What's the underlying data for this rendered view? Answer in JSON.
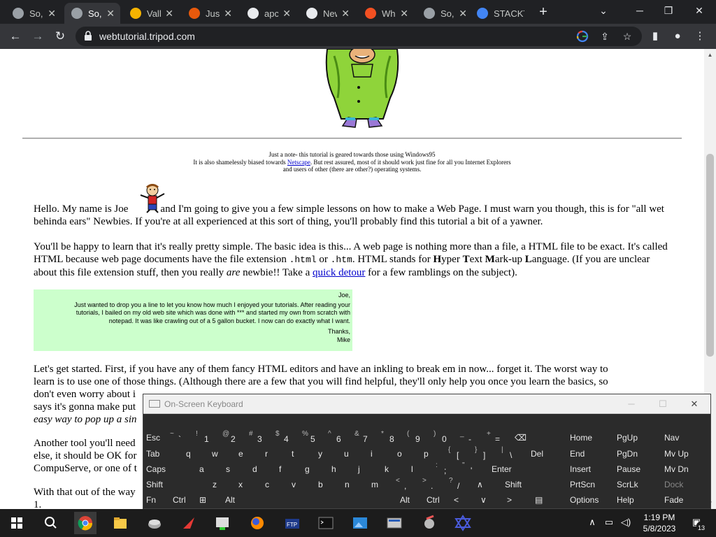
{
  "browser": {
    "tabs": [
      {
        "label": "So,",
        "icon": "globe-icon"
      },
      {
        "label": "So,",
        "icon": "globe-icon",
        "active": true
      },
      {
        "label": "Vall",
        "icon": "valley-logo-icon"
      },
      {
        "label": "Just",
        "icon": "scissors-icon"
      },
      {
        "label": "apc",
        "icon": "museum-icon"
      },
      {
        "label": "New",
        "icon": "chatgpt-icon"
      },
      {
        "label": "Wh",
        "icon": "microsoft-icon"
      },
      {
        "label": "So,",
        "icon": "globe-icon"
      },
      {
        "label": "STACKT",
        "icon": "stack-icon"
      }
    ],
    "url": "webtutorial.tripod.com",
    "new_tab": "+"
  },
  "page": {
    "note_line1": "Just a note- this tutorial is geared towards those using Windows95",
    "note_line2_a": "It is also shamelessly biased towards ",
    "note_link": "Netscape",
    "note_line2_b": ". But rest assured, most of it should work just fine for all you Internet Explorers",
    "note_line3": "and users of other (there are other?) operating systems.",
    "p1_a": "Hello. My name is Joe",
    "p1_b": "and I'm going to give you a few simple lessons on how to make a Web Page. I must warn you though, this is for \"all wet behinda ears\" Newbies. If you're at all experienced at this sort of thing, you'll probably find this tutorial a bit of a yawner.",
    "p2_a": "You'll be happy to learn that it's really pretty simple. The basic idea is this... A web page is nothing more than a file, a HTML file to be exact. It's called HTML because web page documents have the file extension ",
    "p2_ext1": ".html",
    "p2_or": " or ",
    "p2_ext2": ".htm",
    "p2_b": ". HTML stands for ",
    "p2_H": "H",
    "p2_yper": "yper ",
    "p2_T": "T",
    "p2_ext": "ext ",
    "p2_M": "M",
    "p2_arkup": "ark-up ",
    "p2_L": "L",
    "p2_anguage": "anguage. (If you are unclear about this file extension stuff, then you really ",
    "p2_are": "are",
    "p2_newbie": " newbie!! Take a ",
    "p2_link": "quick detour",
    "p2_end": " for a few ramblings on the subject).",
    "letter": {
      "greeting": "Joe,",
      "body": "Just wanted to drop you a line to let you know how much I enjoyed your tutorials. After reading your tutorials, I bailed on my old web site which was done with *** and started my own from scratch with notepad. It was like crawling out of a 5 gallon bucket. I now can do exactly what I want.",
      "thanks": "Thanks,",
      "sign": "Mike"
    },
    "p3_line1": "Let's get started. First, if you have any of them fancy HTML editors and have an inkling to break em in now... forget it. The worst way to",
    "p3_line2": "learn is to use one of those things. (Although there are a few that you will find helpful, they'll only help you once you learn the basics, so",
    "p3_line3": "don't even worry about i",
    "p3_line3b": "else, it should be OK for",
    "p3_says": "says it's gonna make put",
    "p3_easy": "easy way to pop up a sin",
    "p4_line1": "Another tool you'll need",
    "p4_line2": "else, it should be OK for",
    "p4_line3": "CompuServe, or one of t",
    "p5_line1": "With that out of the way",
    "p5_line2": "1."
  },
  "osk": {
    "title": "On-Screen Keyboard",
    "row1": [
      {
        "l": "Esc"
      },
      {
        "u": "~",
        "d": "`"
      },
      {
        "u": "!",
        "d": "1"
      },
      {
        "u": "@",
        "d": "2"
      },
      {
        "u": "#",
        "d": "3"
      },
      {
        "u": "$",
        "d": "4"
      },
      {
        "u": "%",
        "d": "5"
      },
      {
        "u": "^",
        "d": "6"
      },
      {
        "u": "&",
        "d": "7"
      },
      {
        "u": "*",
        "d": "8"
      },
      {
        "u": "(",
        "d": "9"
      },
      {
        "u": ")",
        "d": "0"
      },
      {
        "u": "_",
        "d": "-"
      },
      {
        "u": "+",
        "d": "="
      },
      {
        "l": "⌫"
      }
    ],
    "row2": [
      {
        "l": "Tab"
      },
      {
        "l": "q"
      },
      {
        "l": "w"
      },
      {
        "l": "e"
      },
      {
        "l": "r"
      },
      {
        "l": "t"
      },
      {
        "l": "y"
      },
      {
        "l": "u"
      },
      {
        "l": "i"
      },
      {
        "l": "o"
      },
      {
        "l": "p"
      },
      {
        "u": "{",
        "d": "["
      },
      {
        "u": "}",
        "d": "]"
      },
      {
        "u": "|",
        "d": "\\"
      },
      {
        "l": "Del"
      }
    ],
    "row3": [
      {
        "l": "Caps"
      },
      {
        "l": "a"
      },
      {
        "l": "s"
      },
      {
        "l": "d"
      },
      {
        "l": "f"
      },
      {
        "l": "g"
      },
      {
        "l": "h"
      },
      {
        "l": "j"
      },
      {
        "l": "k"
      },
      {
        "l": "l"
      },
      {
        "u": ":",
        "d": ";"
      },
      {
        "u": "\"",
        "d": "'"
      },
      {
        "l": "Enter"
      }
    ],
    "row4": [
      {
        "l": "Shift"
      },
      {
        "l": "z"
      },
      {
        "l": "x"
      },
      {
        "l": "c"
      },
      {
        "l": "v"
      },
      {
        "l": "b"
      },
      {
        "l": "n"
      },
      {
        "l": "m"
      },
      {
        "u": "<",
        "d": ","
      },
      {
        "u": ">",
        "d": "."
      },
      {
        "u": "?",
        "d": "/"
      },
      {
        "l": "∧"
      },
      {
        "l": "Shift"
      }
    ],
    "row5": [
      {
        "l": "Fn"
      },
      {
        "l": "Ctrl"
      },
      {
        "l": "⊞"
      },
      {
        "l": "Alt"
      },
      {
        "l": ""
      },
      {
        "l": "Alt"
      },
      {
        "l": "Ctrl"
      },
      {
        "l": "<"
      },
      {
        "l": "∨"
      },
      {
        "l": ">"
      },
      {
        "l": "▤"
      }
    ],
    "nav": [
      [
        "Home",
        "PgUp",
        "Nav"
      ],
      [
        "End",
        "PgDn",
        "Mv Up"
      ],
      [
        "Insert",
        "Pause",
        "Mv Dn"
      ],
      [
        "PrtScn",
        "ScrLk",
        "Dock"
      ],
      [
        "Options",
        "Help",
        "Fade"
      ]
    ]
  },
  "taskbar": {
    "time": "1:19 PM",
    "date": "5/8/2023",
    "notifications": "13"
  }
}
